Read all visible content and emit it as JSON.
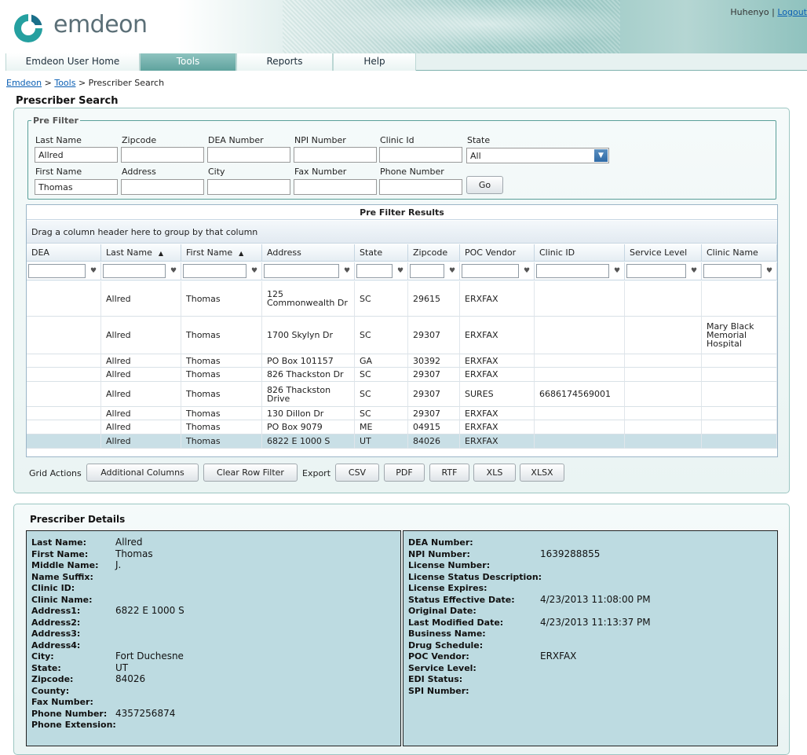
{
  "app": {
    "brand": "emdeon"
  },
  "header": {
    "user": "Huhenyo",
    "separator": "|",
    "logout_label": "Logout"
  },
  "nav": {
    "tabs": [
      "Emdeon User Home",
      "Tools",
      "Reports",
      "Help"
    ],
    "active_tab": "Tools"
  },
  "breadcrumb": {
    "root": "Emdeon",
    "sep1": ">",
    "tools": "Tools",
    "sep2": ">",
    "current": "Prescriber Search"
  },
  "page_title": "Prescriber Search",
  "prefilter": {
    "legend": "Pre Filter",
    "labels": {
      "last_name": "Last Name",
      "zipcode": "Zipcode",
      "dea_number": "DEA Number",
      "npi_number": "NPI Number",
      "clinic_id": "Clinic Id",
      "state": "State",
      "first_name": "First Name",
      "address": "Address",
      "city": "City",
      "fax_number": "Fax Number",
      "phone_number": "Phone Number"
    },
    "values": {
      "last_name": "Allred",
      "zipcode": "",
      "dea_number": "",
      "npi_number": "",
      "clinic_id": "",
      "state": "All",
      "first_name": "Thomas",
      "address": "",
      "city": "",
      "fax_number": "",
      "phone_number": ""
    },
    "go_label": "Go"
  },
  "grid": {
    "title": "Pre Filter Results",
    "group_hint": "Drag a column header here to group by that column",
    "columns": [
      "DEA",
      "Last Name",
      "First Name",
      "Address",
      "State",
      "Zipcode",
      "POC Vendor",
      "Clinic ID",
      "Service Level",
      "Clinic Name"
    ],
    "sort_indicator": "▲",
    "rows": [
      [
        "",
        "Allred",
        "Thomas",
        "125 Commonwealth Dr",
        "SC",
        "29615",
        "ERXFAX",
        "",
        "",
        ""
      ],
      [
        "",
        "Allred",
        "Thomas",
        "1700 Skylyn Dr",
        "SC",
        "29307",
        "ERXFAX",
        "",
        "",
        "Mary Black Memorial Hospital"
      ],
      [
        "",
        "Allred",
        "Thomas",
        "PO Box 101157",
        "GA",
        "30392",
        "ERXFAX",
        "",
        "",
        ""
      ],
      [
        "",
        "Allred",
        "Thomas",
        "826 Thackston Dr",
        "SC",
        "29307",
        "ERXFAX",
        "",
        "",
        ""
      ],
      [
        "",
        "Allred",
        "Thomas",
        "826 Thackston Drive",
        "SC",
        "29307",
        "SURES",
        "6686174569001",
        "",
        ""
      ],
      [
        "",
        "Allred",
        "Thomas",
        "130 Dillon Dr",
        "SC",
        "29307",
        "ERXFAX",
        "",
        "",
        ""
      ],
      [
        "",
        "Allred",
        "Thomas",
        "PO Box 9079",
        "ME",
        "04915",
        "ERXFAX",
        "",
        "",
        ""
      ],
      [
        "",
        "Allred",
        "Thomas",
        "6822 E 1000 S",
        "UT",
        "84026",
        "ERXFAX",
        "",
        "",
        ""
      ]
    ]
  },
  "actions": {
    "grid_actions_label": "Grid Actions",
    "additional_columns": "Additional Columns",
    "clear_row_filter": "Clear Row Filter",
    "export_label": "Export",
    "csv": "CSV",
    "pdf": "PDF",
    "rtf": "RTF",
    "xls": "XLS",
    "xlsx": "XLSX"
  },
  "details": {
    "title": "Prescriber Details",
    "left": [
      {
        "label": "Last Name:",
        "value": "Allred"
      },
      {
        "label": "First Name:",
        "value": "Thomas"
      },
      {
        "label": "Middle Name:",
        "value": "J."
      },
      {
        "label": "Name Suffix:",
        "value": ""
      },
      {
        "label": "Clinic ID:",
        "value": ""
      },
      {
        "label": "Clinic Name:",
        "value": ""
      },
      {
        "label": "Address1:",
        "value": "6822 E 1000 S"
      },
      {
        "label": "Address2:",
        "value": ""
      },
      {
        "label": "Address3:",
        "value": ""
      },
      {
        "label": "Address4:",
        "value": ""
      },
      {
        "label": "City:",
        "value": "Fort Duchesne"
      },
      {
        "label": "State:",
        "value": "UT"
      },
      {
        "label": "Zipcode:",
        "value": "84026"
      },
      {
        "label": "County:",
        "value": ""
      },
      {
        "label": "Fax Number:",
        "value": ""
      },
      {
        "label": "Phone Number:",
        "value": "4357256874"
      },
      {
        "label": "Phone Extension:",
        "value": ""
      }
    ],
    "right": [
      {
        "label": "DEA Number:",
        "value": ""
      },
      {
        "label": "NPI Number:",
        "value": "1639288855"
      },
      {
        "label": "License Number:",
        "value": ""
      },
      {
        "label": "License Status Description:",
        "value": ""
      },
      {
        "label": "License Expires:",
        "value": ""
      },
      {
        "label": "Status Effective Date:",
        "value": "4/23/2013 11:08:00 PM"
      },
      {
        "label": "Original Date:",
        "value": ""
      },
      {
        "label": "Last Modified Date:",
        "value": "4/23/2013 11:13:37 PM"
      },
      {
        "label": "Business Name:",
        "value": ""
      },
      {
        "label": "Drug Schedule:",
        "value": ""
      },
      {
        "label": "POC Vendor:",
        "value": "ERXFAX"
      },
      {
        "label": "Service Level:",
        "value": ""
      },
      {
        "label": "EDI Status:",
        "value": ""
      },
      {
        "label": "SPI Number:",
        "value": ""
      }
    ]
  },
  "colors": {
    "accent": "#5fa39e",
    "link": "#0a5fb4",
    "selected_row": "#c9dfe6",
    "details_bg": "#bddbe1"
  },
  "icons": {
    "logo": "emdeon-logo-icon",
    "filter": "filter-icon",
    "dropdown": "chevron-down-icon"
  }
}
